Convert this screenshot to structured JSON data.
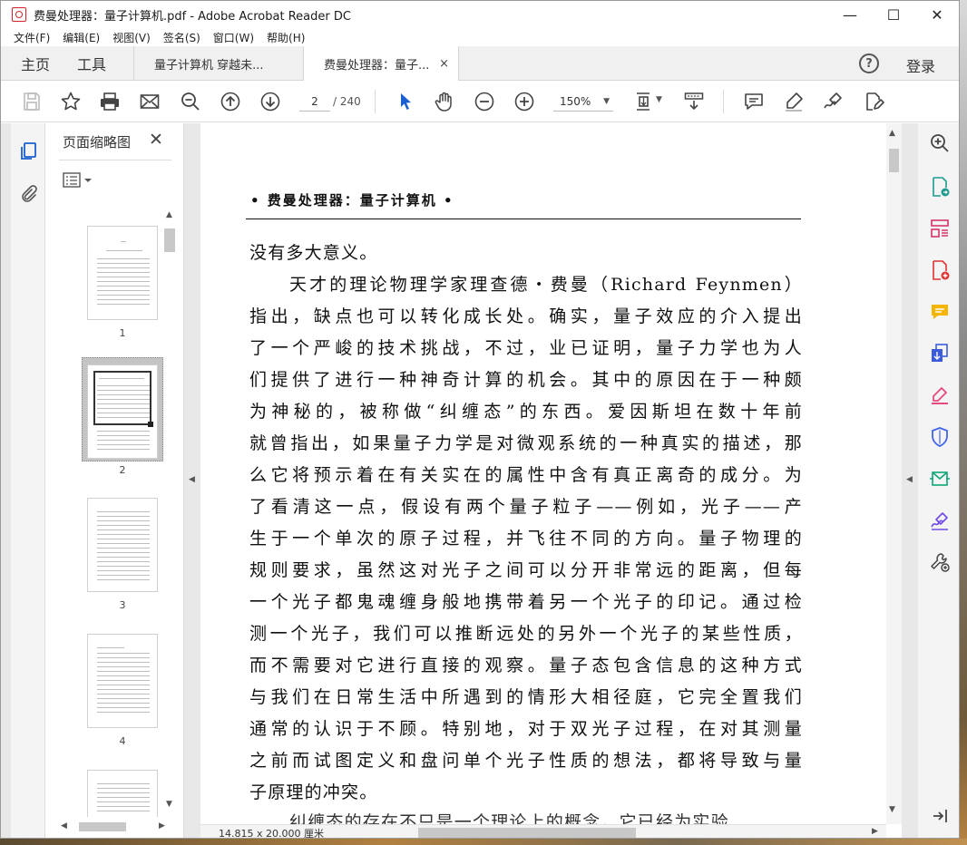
{
  "window": {
    "title": "费曼处理器：量子计算机.pdf - Adobe Acrobat Reader DC",
    "minimize": "—",
    "maximize": "☐",
    "close": "✕"
  },
  "menu": [
    "文件(F)",
    "编辑(E)",
    "视图(V)",
    "签名(S)",
    "窗口(W)",
    "帮助(H)"
  ],
  "tabs": {
    "home": "主页",
    "tools": "工具",
    "doc1": "量子计算机 穿越未...",
    "doc2": "费曼处理器：量子...",
    "close": "×",
    "help": "?",
    "login": "登录"
  },
  "toolbar": {
    "page_current": "2",
    "page_total": "/ 240",
    "zoom": "150%"
  },
  "thumbnail_panel": {
    "title": "页面缩略图",
    "close": "✕",
    "pages": [
      "1",
      "2",
      "3",
      "4"
    ]
  },
  "document": {
    "running_head": "• 费曼处理器：量子计算机 •",
    "lines": [
      "没有多大意义。",
      "天才的理论物理学家理查德・费曼（Richard Feynmen）",
      "指出，缺点也可以转化成长处。确实，量子效应的介入提出",
      "了一个严峻的技术挑战，不过，业已证明，量子力学也为人",
      "们提供了进行一种神奇计算的机会。其中的原因在于一种颇",
      "为神秘的，被称做“纠缠态”的东西。爱因斯坦在数十年前",
      "就曾指出，如果量子力学是对微观系统的一种真实的描述，那",
      "么它将预示着在有关实在的属性中含有真正离奇的成分。为",
      "了看清这一点，假设有两个量子粒子——例如，光子——产",
      "生于一个单次的原子过程，并飞往不同的方向。量子物理的",
      "规则要求，虽然这对光子之间可以分开非常远的距离，但每",
      "一个光子都鬼魂缠身般地携带着另一个光子的印记。通过检",
      "测一个光子，我们可以推断远处的另外一个光子的某些性质，",
      "而不需要对它进行直接的观察。量子态包含信息的这种方式",
      "与我们在日常生活中所遇到的情形大相径庭，它完全置我们",
      "通常的认识于不顾。特别地，对于双光子过程，在对其测量",
      "之前而试图定义和盘问单个光子性质的想法，都将导致与量",
      "子原理的冲突。"
    ],
    "partial_line": "纠缠态的存在不只是一个理论上的概念，它已经为实验"
  },
  "status": {
    "page_size": "14.815 x 20.000 厘米"
  }
}
